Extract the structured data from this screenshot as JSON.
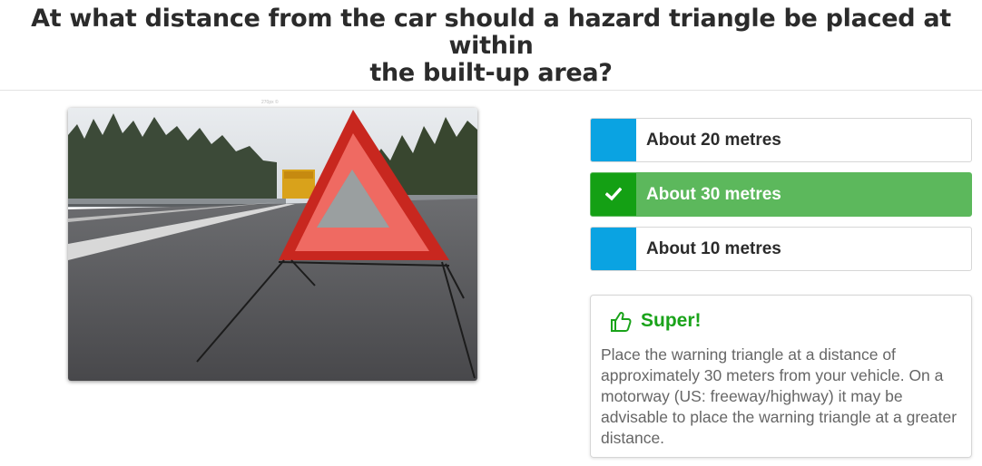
{
  "question": {
    "line1": "At what distance from the car should a hazard triangle be placed at within",
    "line2": "the built-up area?"
  },
  "image": {
    "caption": "270px ©",
    "icon": "hazard-triangle-photo"
  },
  "answers": [
    {
      "label": "About 20 metres",
      "state": "neutral"
    },
    {
      "label": "About 30 metres",
      "state": "correct",
      "icon": "check-icon"
    },
    {
      "label": "About 10 metres",
      "state": "neutral"
    }
  ],
  "feedback": {
    "icon": "thumbs-up-icon",
    "title": "Super!",
    "text": "Place the warning triangle at a distance of approximately 30 meters from your vehicle. On a motorway (US: freeway/highway) it may be advisable to place the warning triangle at a greater distance."
  },
  "colors": {
    "accent": "#0aa3e2",
    "correct": "#5cb85c",
    "correct_dark": "#14a014",
    "feedback_title": "#1aa31a"
  }
}
